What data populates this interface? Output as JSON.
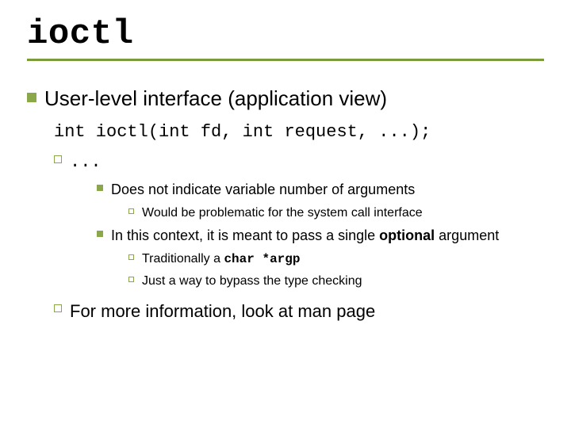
{
  "slide": {
    "title": "ioctl",
    "items": [
      {
        "level": 1,
        "text": "User-level interface (application view)"
      },
      {
        "level": "code",
        "text": "int ioctl(int fd, int request, ...);"
      },
      {
        "level": 2,
        "text": "..."
      },
      {
        "level": 3,
        "text": "Does not indicate variable number of arguments"
      },
      {
        "level": 4,
        "text": "Would be problematic for the system call interface"
      },
      {
        "level": 3,
        "text_pre": "In this context, it is meant to pass a single ",
        "bold": "optional",
        "text_post": " argument"
      },
      {
        "level": 4,
        "text_pre": "Traditionally a ",
        "mono_bold": "char *argp"
      },
      {
        "level": 4,
        "text": "Just a way to bypass the type checking"
      },
      {
        "level": 2,
        "text": "For more information, look at man page"
      }
    ]
  }
}
